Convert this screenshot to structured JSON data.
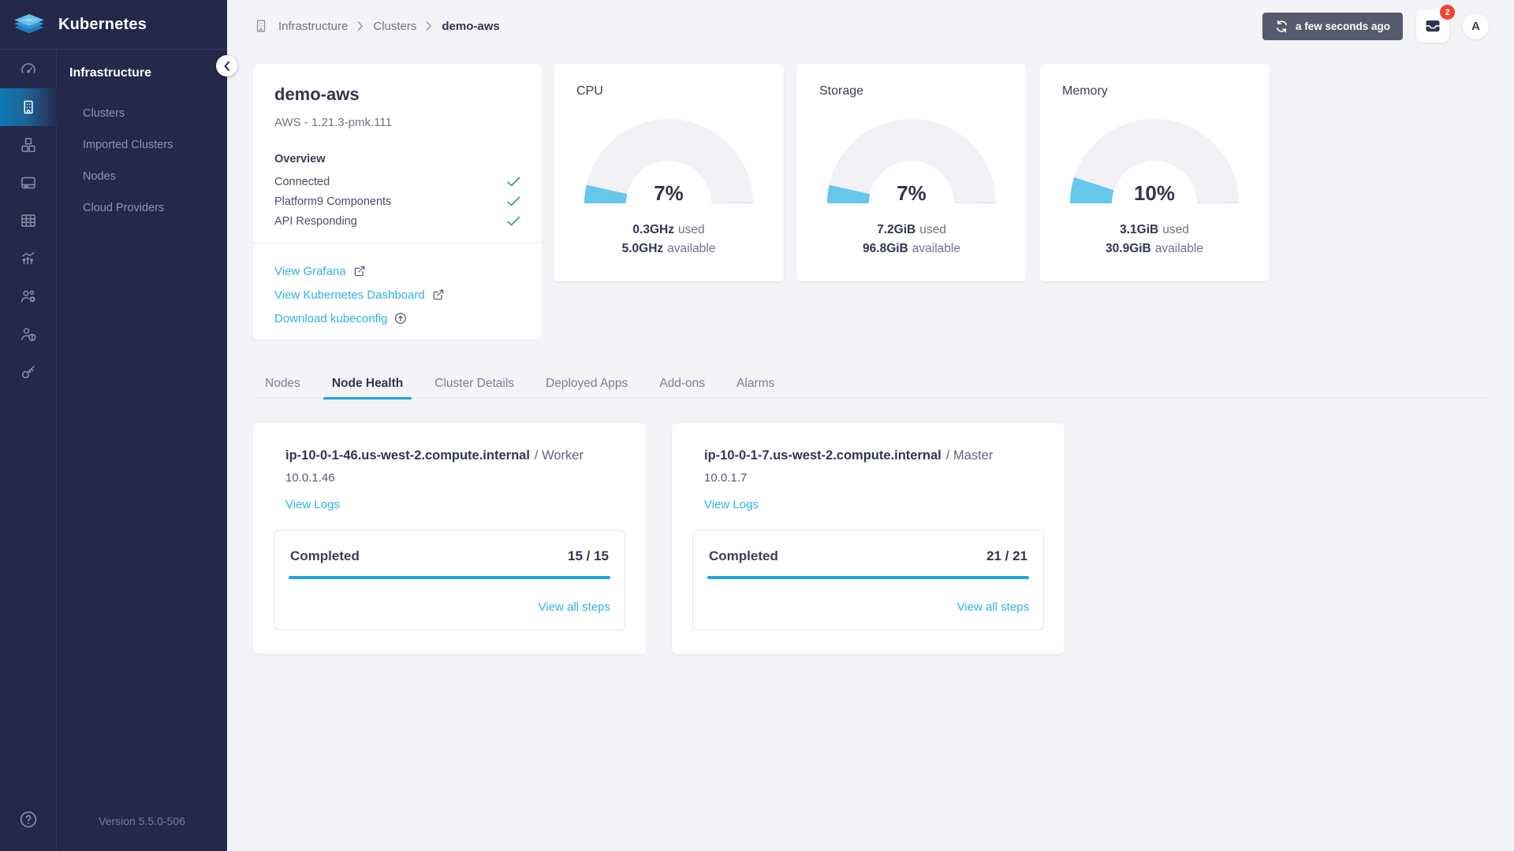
{
  "app": {
    "title": "Kubernetes"
  },
  "sidebar": {
    "section_title": "Infrastructure",
    "items": [
      {
        "label": "Clusters"
      },
      {
        "label": "Imported Clusters"
      },
      {
        "label": "Nodes"
      },
      {
        "label": "Cloud Providers"
      }
    ],
    "rail_icons": [
      "dashboard",
      "infrastructure",
      "apps",
      "workloads",
      "namespaces",
      "monitoring",
      "users",
      "rbac",
      "api-access"
    ],
    "active_icon": "infrastructure",
    "help_icon": "help",
    "version": "Version 5.5.0-506"
  },
  "header": {
    "breadcrumb": {
      "root": "Infrastructure",
      "section": "Clusters",
      "current": "demo-aws"
    },
    "refresh_label": "a few seconds ago",
    "notifications_count": "2",
    "avatar_initial": "A"
  },
  "cluster_card": {
    "title": "demo-aws",
    "subtitle": "AWS - 1.21.3-pmk.111",
    "overview_title": "Overview",
    "checks": [
      {
        "label": "Connected"
      },
      {
        "label": "Platform9 Components"
      },
      {
        "label": "API Responding"
      }
    ],
    "links": [
      {
        "label": "View Grafana",
        "icon": "external-link"
      },
      {
        "label": "View Kubernetes Dashboard",
        "icon": "external-link"
      },
      {
        "label": "Download kubeconfig",
        "icon": "upload-circle"
      }
    ]
  },
  "gauges": [
    {
      "title": "CPU",
      "percent": 7,
      "percent_label": "7%",
      "used_value": "0.3GHz",
      "used_word": "used",
      "available_value": "5.0GHz",
      "available_word": "available"
    },
    {
      "title": "Storage",
      "percent": 7,
      "percent_label": "7%",
      "used_value": "7.2GiB",
      "used_word": "used",
      "available_value": "96.8GiB",
      "available_word": "available"
    },
    {
      "title": "Memory",
      "percent": 10,
      "percent_label": "10%",
      "used_value": "3.1GiB",
      "used_word": "used",
      "available_value": "30.9GiB",
      "available_word": "available"
    }
  ],
  "tabs": [
    {
      "label": "Nodes",
      "active": false
    },
    {
      "label": "Node Health",
      "active": true
    },
    {
      "label": "Cluster Details",
      "active": false
    },
    {
      "label": "Deployed Apps",
      "active": false
    },
    {
      "label": "Add-ons",
      "active": false
    },
    {
      "label": "Alarms",
      "active": false
    }
  ],
  "node_cards": [
    {
      "hostname": "ip-10-0-1-46.us-west-2.compute.internal",
      "role_suffix": "/ Worker",
      "ip": "10.0.1.46",
      "logs_label": "View Logs",
      "status_label": "Completed",
      "progress_label": "15 / 15",
      "progress_percent": 100,
      "steps_label": "View all steps"
    },
    {
      "hostname": "ip-10-0-1-7.us-west-2.compute.internal",
      "role_suffix": "/ Master",
      "ip": "10.0.1.7",
      "logs_label": "View Logs",
      "status_label": "Completed",
      "progress_label": "21 / 21",
      "progress_percent": 100,
      "steps_label": "View all steps"
    }
  ],
  "colors": {
    "accent_link": "#2FB1E8",
    "progress_blue": "#1FA3DC",
    "gauge_fill": "#66C7EC",
    "gauge_track": "#F1F1F6",
    "sidebar_bg": "#24284A",
    "success_green": "#1EA35B",
    "badge_red": "#F44336",
    "refresh_button_bg": "#575A6C",
    "text_dark": "#32364E",
    "text_gray": "#6F7288"
  }
}
